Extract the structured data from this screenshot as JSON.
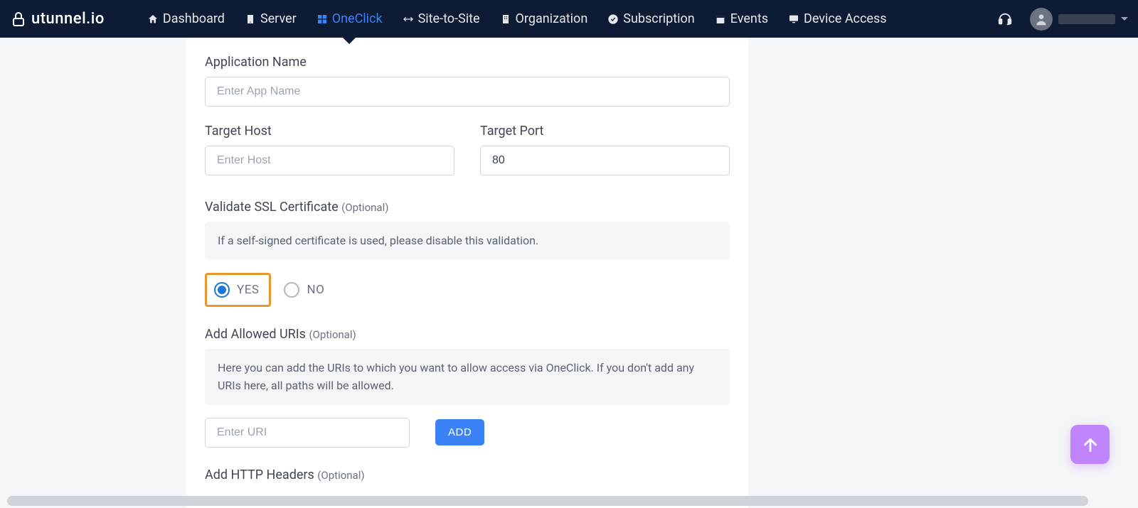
{
  "brand": "utunnel.io",
  "nav": {
    "dashboard": "Dashboard",
    "server": "Server",
    "oneclick": "OneClick",
    "sitetosite": "Site-to-Site",
    "organization": "Organization",
    "subscription": "Subscription",
    "events": "Events",
    "deviceaccess": "Device Access"
  },
  "form": {
    "appname": {
      "label": "Application Name",
      "placeholder": "Enter App Name"
    },
    "targethost": {
      "label": "Target Host",
      "placeholder": "Enter Host"
    },
    "targetport": {
      "label": "Target Port",
      "value": "80"
    },
    "ssl": {
      "label": "Validate SSL Certificate",
      "optional": "(Optional)",
      "info": "If a self-signed certificate is used, please disable this validation.",
      "yes": "YES",
      "no": "NO"
    },
    "uris": {
      "label": "Add Allowed URIs",
      "optional": "(Optional)",
      "info": "Here you can add the URIs to which you want to allow access via OneClick. If you don't add any URIs here, all paths will be allowed.",
      "placeholder": "Enter URI",
      "addbtn": "ADD"
    },
    "headers": {
      "label": "Add HTTP Headers",
      "optional": "(Optional)"
    }
  }
}
